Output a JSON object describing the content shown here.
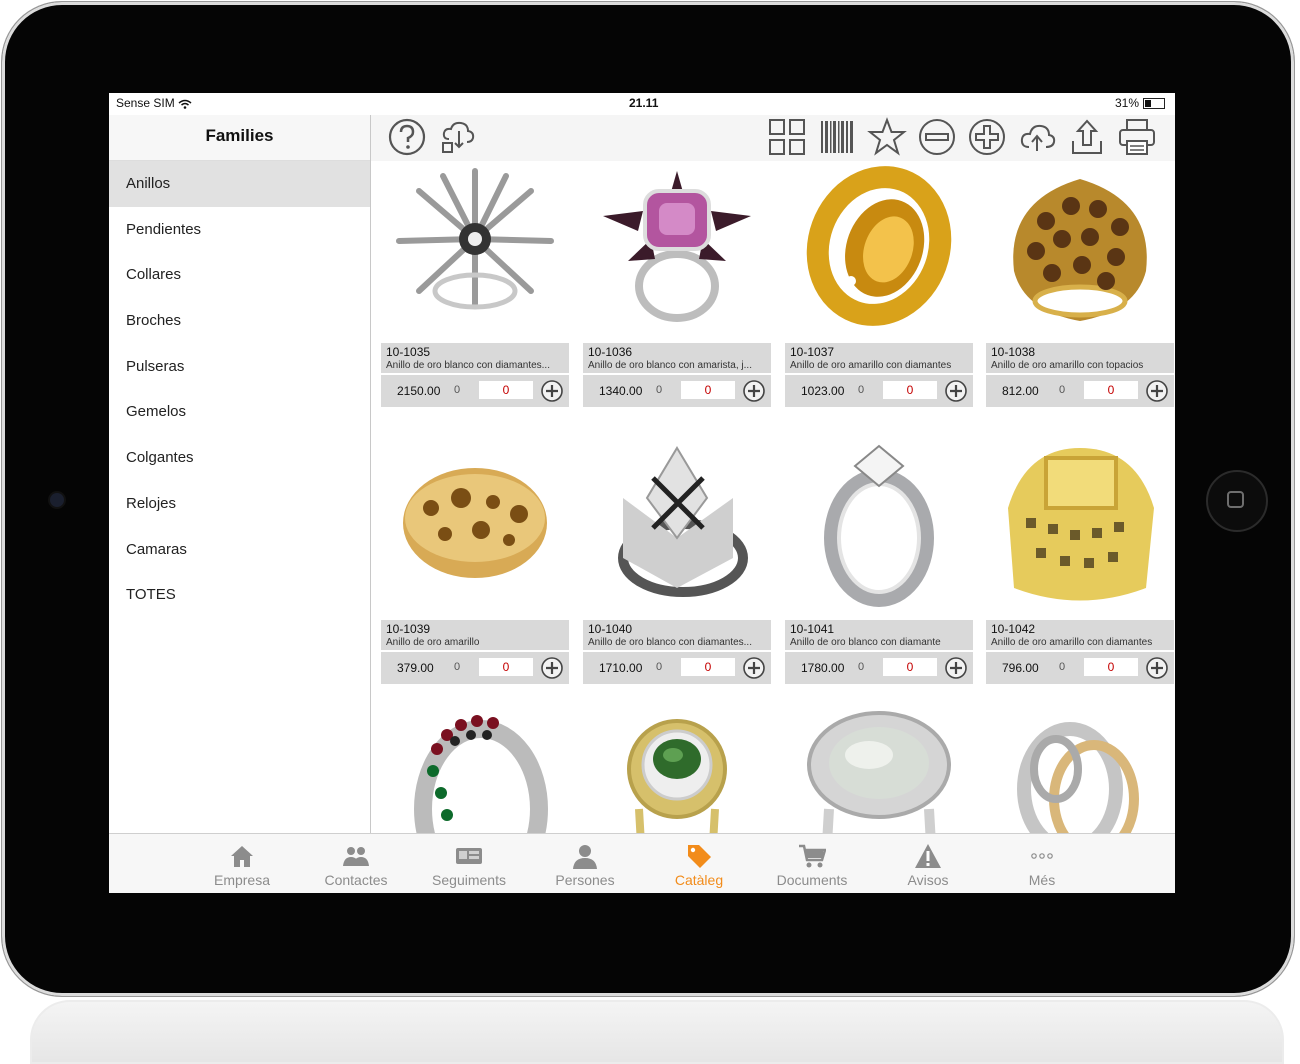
{
  "status_bar": {
    "carrier": "Sense SIM",
    "time": "21.11",
    "battery": "31%"
  },
  "sidebar": {
    "title": "Families",
    "items": [
      "Anillos",
      "Pendientes",
      "Collares",
      "Broches",
      "Pulseras",
      "Gemelos",
      "Colgantes",
      "Relojes",
      "Camaras",
      "TOTES"
    ],
    "active": "Anillos"
  },
  "toolbar": {
    "icons": [
      "help-icon",
      "cloud-sync-icon",
      "grid-view-icon",
      "barcode-icon",
      "star-icon",
      "minus-icon",
      "plus-icon",
      "cloud-upload-icon",
      "share-icon",
      "print-icon"
    ]
  },
  "products": [
    {
      "code": "10-1035",
      "desc": "Anillo de oro blanco con diamantes...",
      "price": "2150.00",
      "qty": "0",
      "input": "0"
    },
    {
      "code": "10-1036",
      "desc": "Anillo de oro blanco con amarista, j...",
      "price": "1340.00",
      "qty": "0",
      "input": "0"
    },
    {
      "code": "10-1037",
      "desc": "Anillo de oro amarillo con diamantes",
      "price": "1023.00",
      "qty": "0",
      "input": "0"
    },
    {
      "code": "10-1038",
      "desc": "Anillo de oro amarillo con topacios",
      "price": "812.00",
      "qty": "0",
      "input": "0"
    },
    {
      "code": "10-1039",
      "desc": "Anillo de oro amarillo",
      "price": "379.00",
      "qty": "0",
      "input": "0"
    },
    {
      "code": "10-1040",
      "desc": "Anillo de oro blanco con diamantes...",
      "price": "1710.00",
      "qty": "0",
      "input": "0"
    },
    {
      "code": "10-1041",
      "desc": "Anillo de oro blanco con diamante",
      "price": "1780.00",
      "qty": "0",
      "input": "0"
    },
    {
      "code": "10-1042",
      "desc": "Anillo de oro amarillo con diamantes",
      "price": "796.00",
      "qty": "0",
      "input": "0"
    }
  ],
  "tabbar": {
    "items": [
      {
        "label": "Empresa",
        "icon": "house-icon"
      },
      {
        "label": "Contactes",
        "icon": "contacts-icon"
      },
      {
        "label": "Seguiments",
        "icon": "followup-icon"
      },
      {
        "label": "Persones",
        "icon": "person-icon"
      },
      {
        "label": "Catàleg",
        "icon": "tag-icon"
      },
      {
        "label": "Documents",
        "icon": "cart-icon"
      },
      {
        "label": "Avisos",
        "icon": "warning-icon"
      },
      {
        "label": "Més",
        "icon": "more-icon"
      }
    ],
    "active": "Catàleg"
  },
  "colors": {
    "accent": "#f28c1b",
    "qty_text": "#c40000",
    "card_bg": "#d9d9d9"
  }
}
